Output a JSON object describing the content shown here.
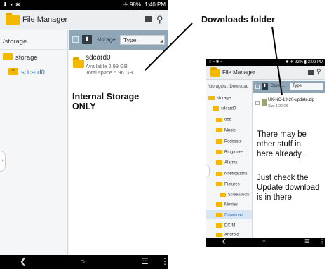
{
  "left_phone": {
    "status": {
      "left_icons": "⬇ ▪ ✱",
      "right_icons": "✈ 98%",
      "time": "1:40 PM"
    },
    "app_title": "File Manager",
    "path": "/storage",
    "tree": [
      {
        "label": "storage"
      },
      {
        "label": "sdcard0"
      }
    ],
    "toolbar": {
      "crumb": "storage",
      "type_label": "Type"
    },
    "file": {
      "name": "sdcard0",
      "available": "Available 2.99 GB",
      "total": "Total space 5.96 GB"
    },
    "nav": {
      "back": "❮",
      "home": "○",
      "menu": "☰",
      "more": "⋮"
    }
  },
  "annotations": {
    "downloads_title": "Downloads folder",
    "internal_note": "Internal Storage ONLY",
    "other_stuff": [
      "There may be",
      "other stuff in",
      "here already.."
    ],
    "check_update": [
      "Just check the",
      "Update download",
      "is in there"
    ]
  },
  "right_phone": {
    "status": {
      "left_icons": "⬇ ▪ ✱ ▪",
      "right_icons": "✱ ✈ 92% ▮",
      "time": "2:02 PM"
    },
    "app_title": "File Manager",
    "path": "/storage/s...Download",
    "toolbar": {
      "crumb": "Down...",
      "type_label": "Type"
    },
    "file": {
      "name": "UK-NC-19-20-update.zip",
      "size": "Size 1.26 GB"
    },
    "tree": [
      {
        "label": "storage"
      },
      {
        "label": "sdcard0"
      },
      {
        "label": "obb"
      },
      {
        "label": "Music"
      },
      {
        "label": "Podcasts"
      },
      {
        "label": "Ringtones"
      },
      {
        "label": "Alarms"
      },
      {
        "label": "Notifications"
      },
      {
        "label": "Pictures"
      },
      {
        "label": "Screenshots"
      },
      {
        "label": "Movies"
      },
      {
        "label": "Download"
      },
      {
        "label": "DCIM"
      },
      {
        "label": "Android"
      }
    ],
    "nav": {
      "back": "❮",
      "home": "○",
      "menu": "☰",
      "more": "⋮"
    }
  }
}
